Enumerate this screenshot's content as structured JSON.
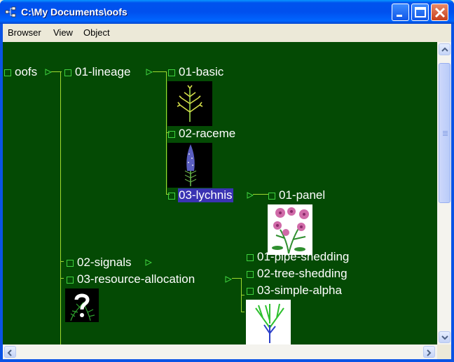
{
  "window": {
    "title": "C:\\My Documents\\oofs"
  },
  "menu": [
    "Browser",
    "View",
    "Object"
  ],
  "tree": {
    "root": "oofs",
    "n_lineage": "01-lineage",
    "n_basic": "01-basic",
    "n_raceme": "02-raceme",
    "n_lychnis": "03-lychnis",
    "n_panel": "01-panel",
    "n_signals": "02-signals",
    "n_resource": "03-resource-allocation",
    "n_pipe": "01-pipe-shedding",
    "n_treeshed": "02-tree-shedding",
    "n_simple": "03-simple-alpha"
  },
  "colors": {
    "tree_background": "#044a04",
    "connector": "#9fd82f",
    "selection": "#3a33b3",
    "node_box": "#3fd23f"
  }
}
